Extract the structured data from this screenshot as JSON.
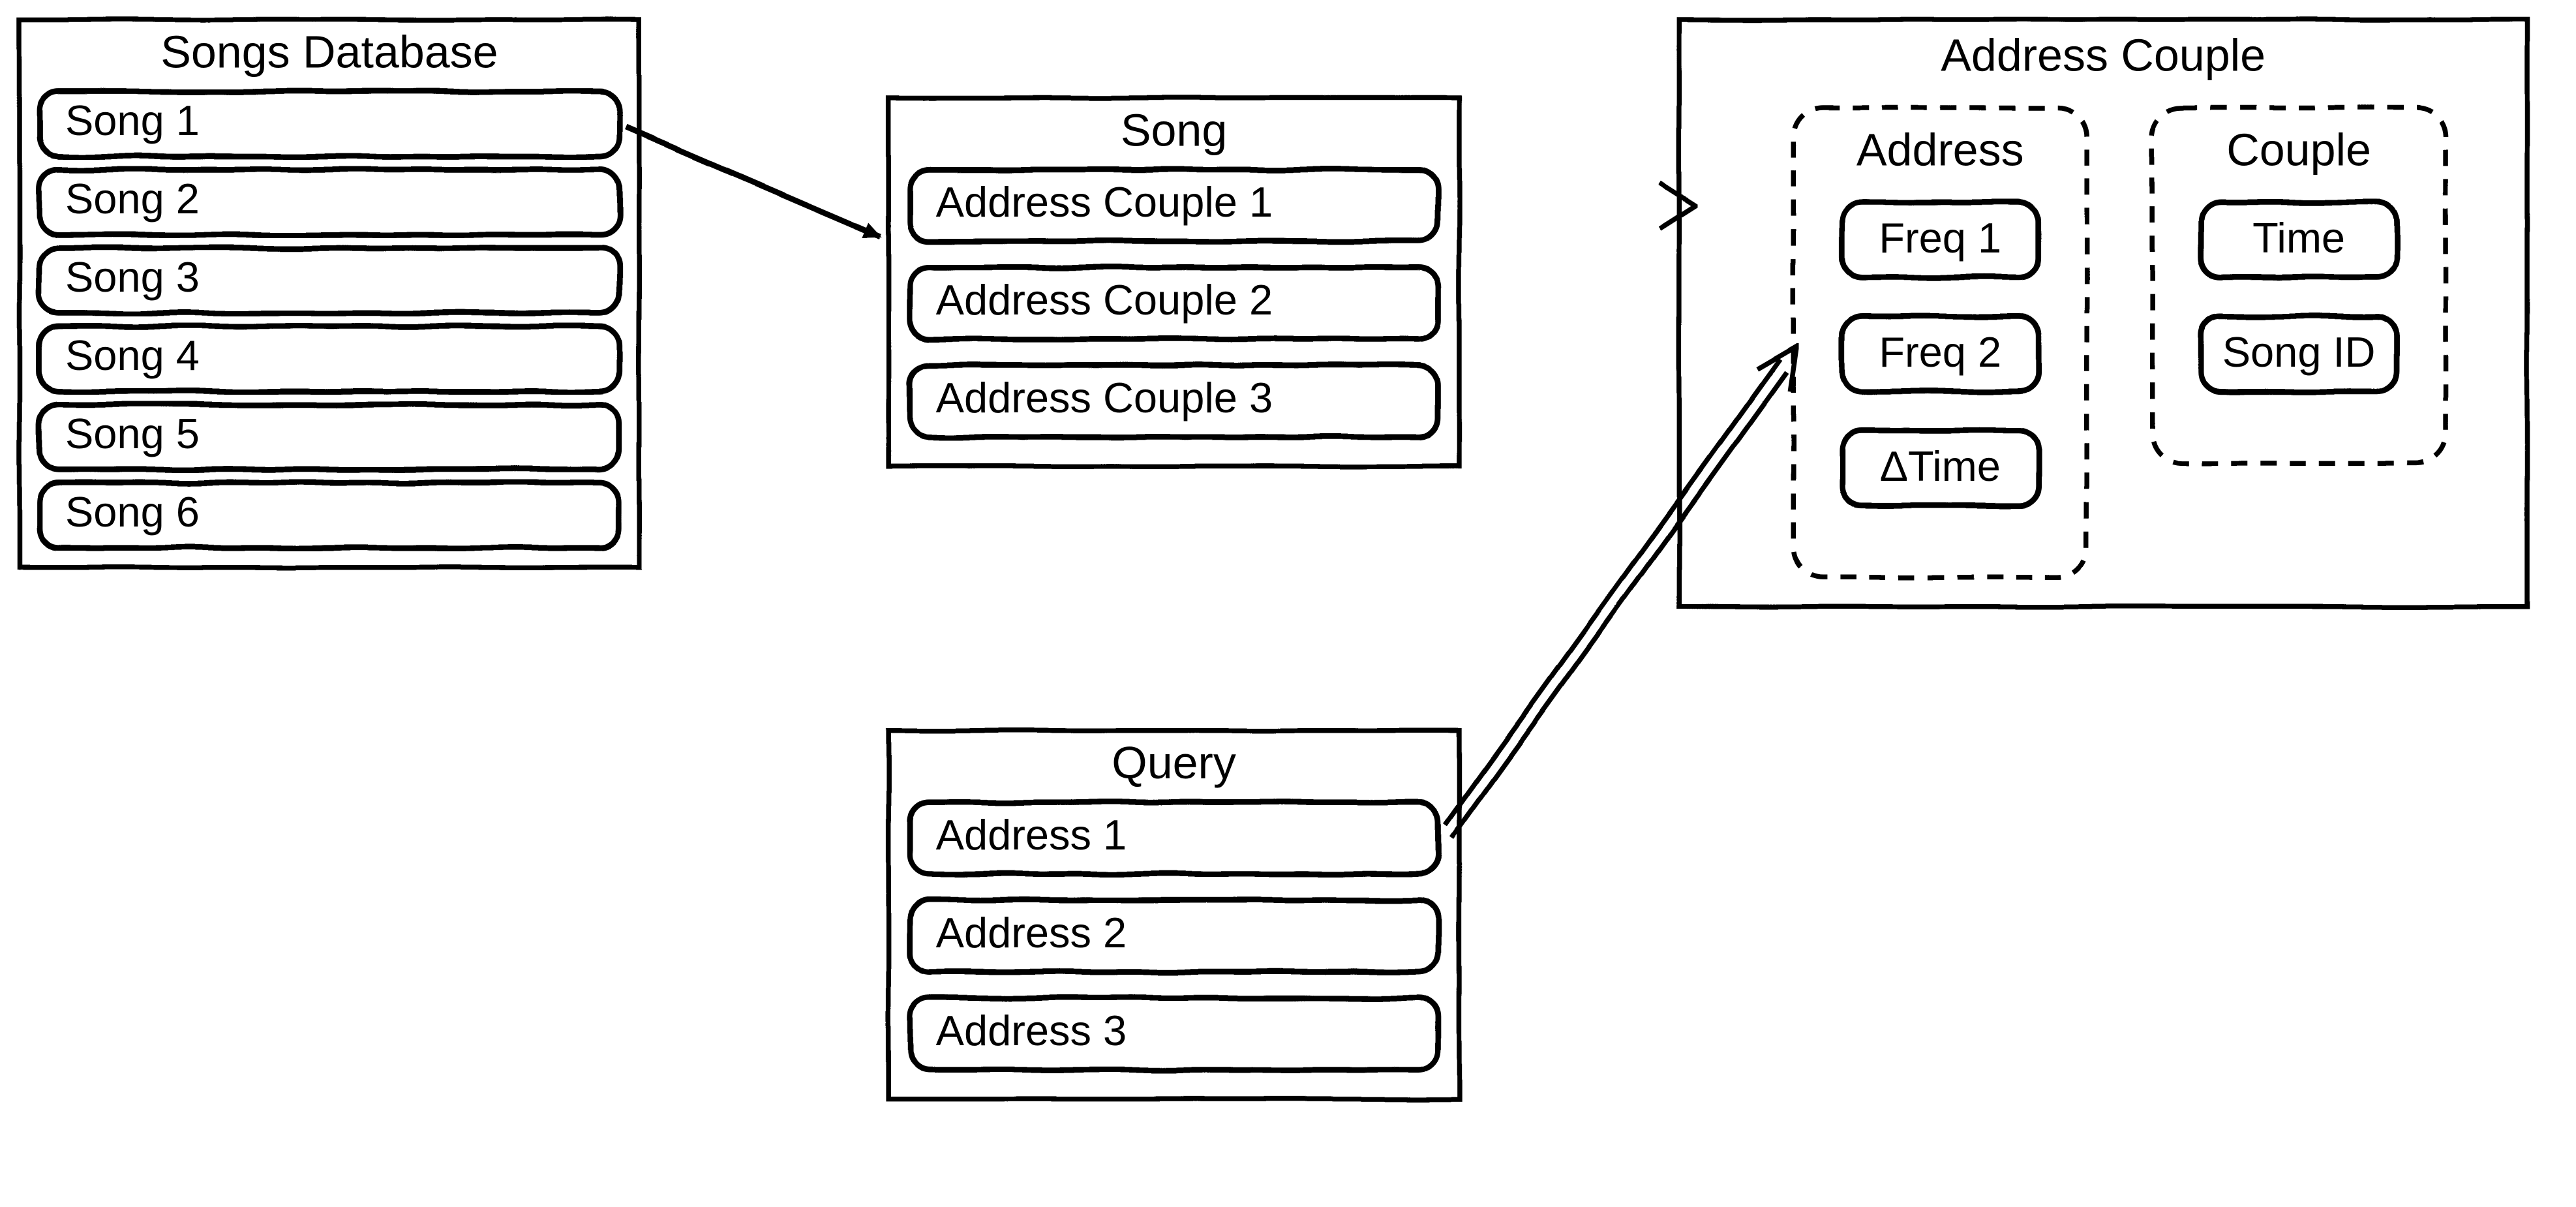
{
  "songs_database": {
    "title": "Songs Database",
    "items": [
      "Song 1",
      "Song 2",
      "Song 3",
      "Song 4",
      "Song 5",
      "Song 6"
    ]
  },
  "song": {
    "title": "Song",
    "items": [
      "Address Couple 1",
      "Address Couple 2",
      "Address Couple 3"
    ]
  },
  "query": {
    "title": "Query",
    "items": [
      "Address 1",
      "Address 2",
      "Address 3"
    ]
  },
  "address_couple": {
    "title": "Address Couple",
    "address": {
      "title": "Address",
      "items": [
        "Freq 1",
        "Freq 2",
        "ΔTime"
      ]
    },
    "couple": {
      "title": "Couple",
      "items": [
        "Time",
        "Song ID"
      ]
    }
  }
}
